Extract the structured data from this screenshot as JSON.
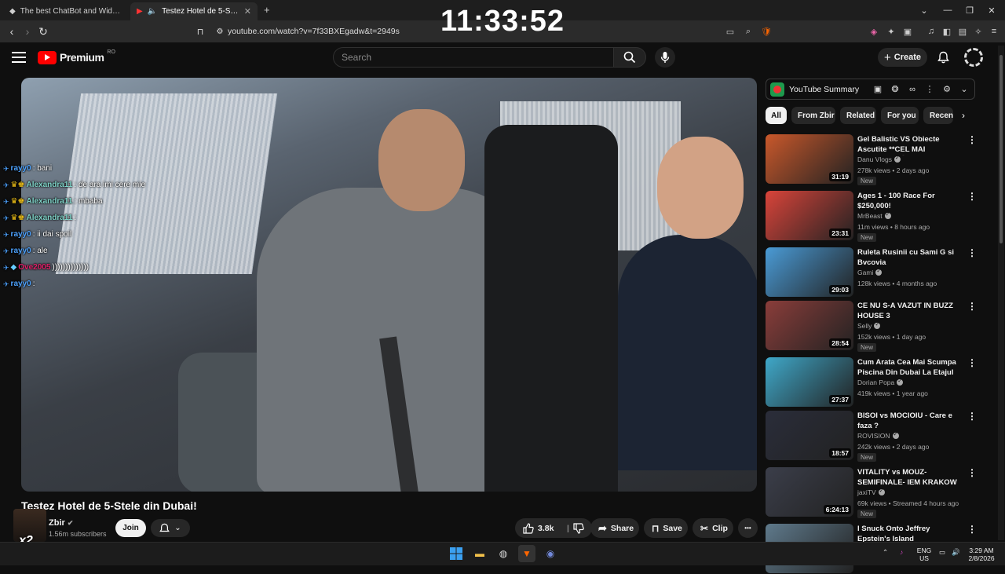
{
  "browser": {
    "tabs": [
      {
        "title": "The best ChatBot and Widgets for Ki",
        "active": false
      },
      {
        "title": "Testez Hotel de 5-Stele din D",
        "active": true
      }
    ],
    "new_tab": "+",
    "url": "youtube.com/watch?v=7f33BXEgadw&t=2949s",
    "window_controls": [
      "⌄",
      "—",
      "❐",
      "✕"
    ]
  },
  "overlay_clock": "11:33:52",
  "youtube": {
    "logo_text": "Premium",
    "logo_region": "RO",
    "search_placeholder": "Search",
    "create_label": "Create"
  },
  "chat_overlay": [
    {
      "user": "rayy0",
      "user_color": "#4da3ff",
      "message": ": bani"
    },
    {
      "user": "Alexandra11",
      "user_color": "#7fd3c8",
      "message": ": de ara imi cere mie"
    },
    {
      "user": "Alexandra11",
      "user_color": "#7fd3c8",
      "message": ": mbaba"
    },
    {
      "user": "Alexandra11",
      "user_color": "#7fd3c8",
      "message": ": "
    },
    {
      "user": "rayy0",
      "user_color": "#4da3ff",
      "message": ": ii dai spoil"
    },
    {
      "user": "rayy0",
      "user_color": "#4da3ff",
      "message": ": ale"
    },
    {
      "user": "Ove2005",
      "user_color": "#e2216b",
      "message": " ))))))))))))))"
    },
    {
      "user": "rayy0",
      "user_color": "#4da3ff",
      "message": ": "
    }
  ],
  "video": {
    "title": "Testez Hotel de 5-Stele din Dubai!",
    "channel": "Zbir",
    "subscribers": "1.56m subscribers",
    "join_label": "Join",
    "avatar_overlay": "x2",
    "likes": "3.8k",
    "share_label": "Share",
    "save_label": "Save",
    "clip_label": "Clip",
    "more_label": "•••"
  },
  "sidebar": {
    "summary_title": "YouTube Summary",
    "chips": [
      "All",
      "From Zbir",
      "Related",
      "For you",
      "Recen"
    ],
    "recommendations": [
      {
        "title": "Gel Balistic VS Obiecte Ascutite **CEL MAI REZISTENT😱**",
        "channel": "Danu Vlogs",
        "verified": true,
        "meta": "278k views • 2 days ago",
        "badge": "New",
        "duration": "31:19",
        "thumb_color": "#c9582b"
      },
      {
        "title": "Ages 1 - 100 Race For $250,000!",
        "channel": "MrBeast",
        "verified": true,
        "meta": "11m views • 8 hours ago",
        "badge": "New",
        "duration": "23:31",
        "thumb_color": "#d9443a"
      },
      {
        "title": "Ruleta Rusinii cu Sami G si Bvcovia",
        "channel": "Gami",
        "verified": true,
        "meta": "128k views • 4 months ago",
        "badge": "",
        "duration": "29:03",
        "thumb_color": "#4a9bd6"
      },
      {
        "title": "CE NU S-A VAZUT IN BUZZ HOUSE 3",
        "channel": "Selly",
        "verified": true,
        "meta": "152k views • 1 day ago",
        "badge": "New",
        "duration": "28:54",
        "thumb_color": "#8a3d3a"
      },
      {
        "title": "Cum Arata Cea Mai Scumpa Piscina Din Dubai La Etajul 50 ...",
        "channel": "Dorian Popa",
        "verified": true,
        "meta": "419k views • 1 year ago",
        "badge": "",
        "duration": "27:37",
        "thumb_color": "#3fa8c9"
      },
      {
        "title": "BISOI vs MOCIOIU - Care e faza ?",
        "channel": "ROVISION",
        "verified": true,
        "meta": "242k views • 2 days ago",
        "badge": "New",
        "duration": "18:57",
        "thumb_color": "#2a2d3a"
      },
      {
        "title": "VITALITY vs MOUZ- SEMIFINALE- IEM KRAKOW ...",
        "channel": "jaxiTV",
        "verified": true,
        "meta": "69k views • Streamed 4 hours ago",
        "badge": "New",
        "duration": "6:24:13",
        "thumb_color": "#3b3e4a"
      },
      {
        "title": "I Snuck Onto Jeffrey Epstein's Island",
        "channel": "",
        "verified": false,
        "meta": "",
        "badge": "",
        "duration": "",
        "thumb_color": "#5f7a8c"
      }
    ]
  },
  "taskbar": {
    "lang": "ENG",
    "region": "US",
    "time": "3:29 AM",
    "date": "2/8/2026"
  }
}
